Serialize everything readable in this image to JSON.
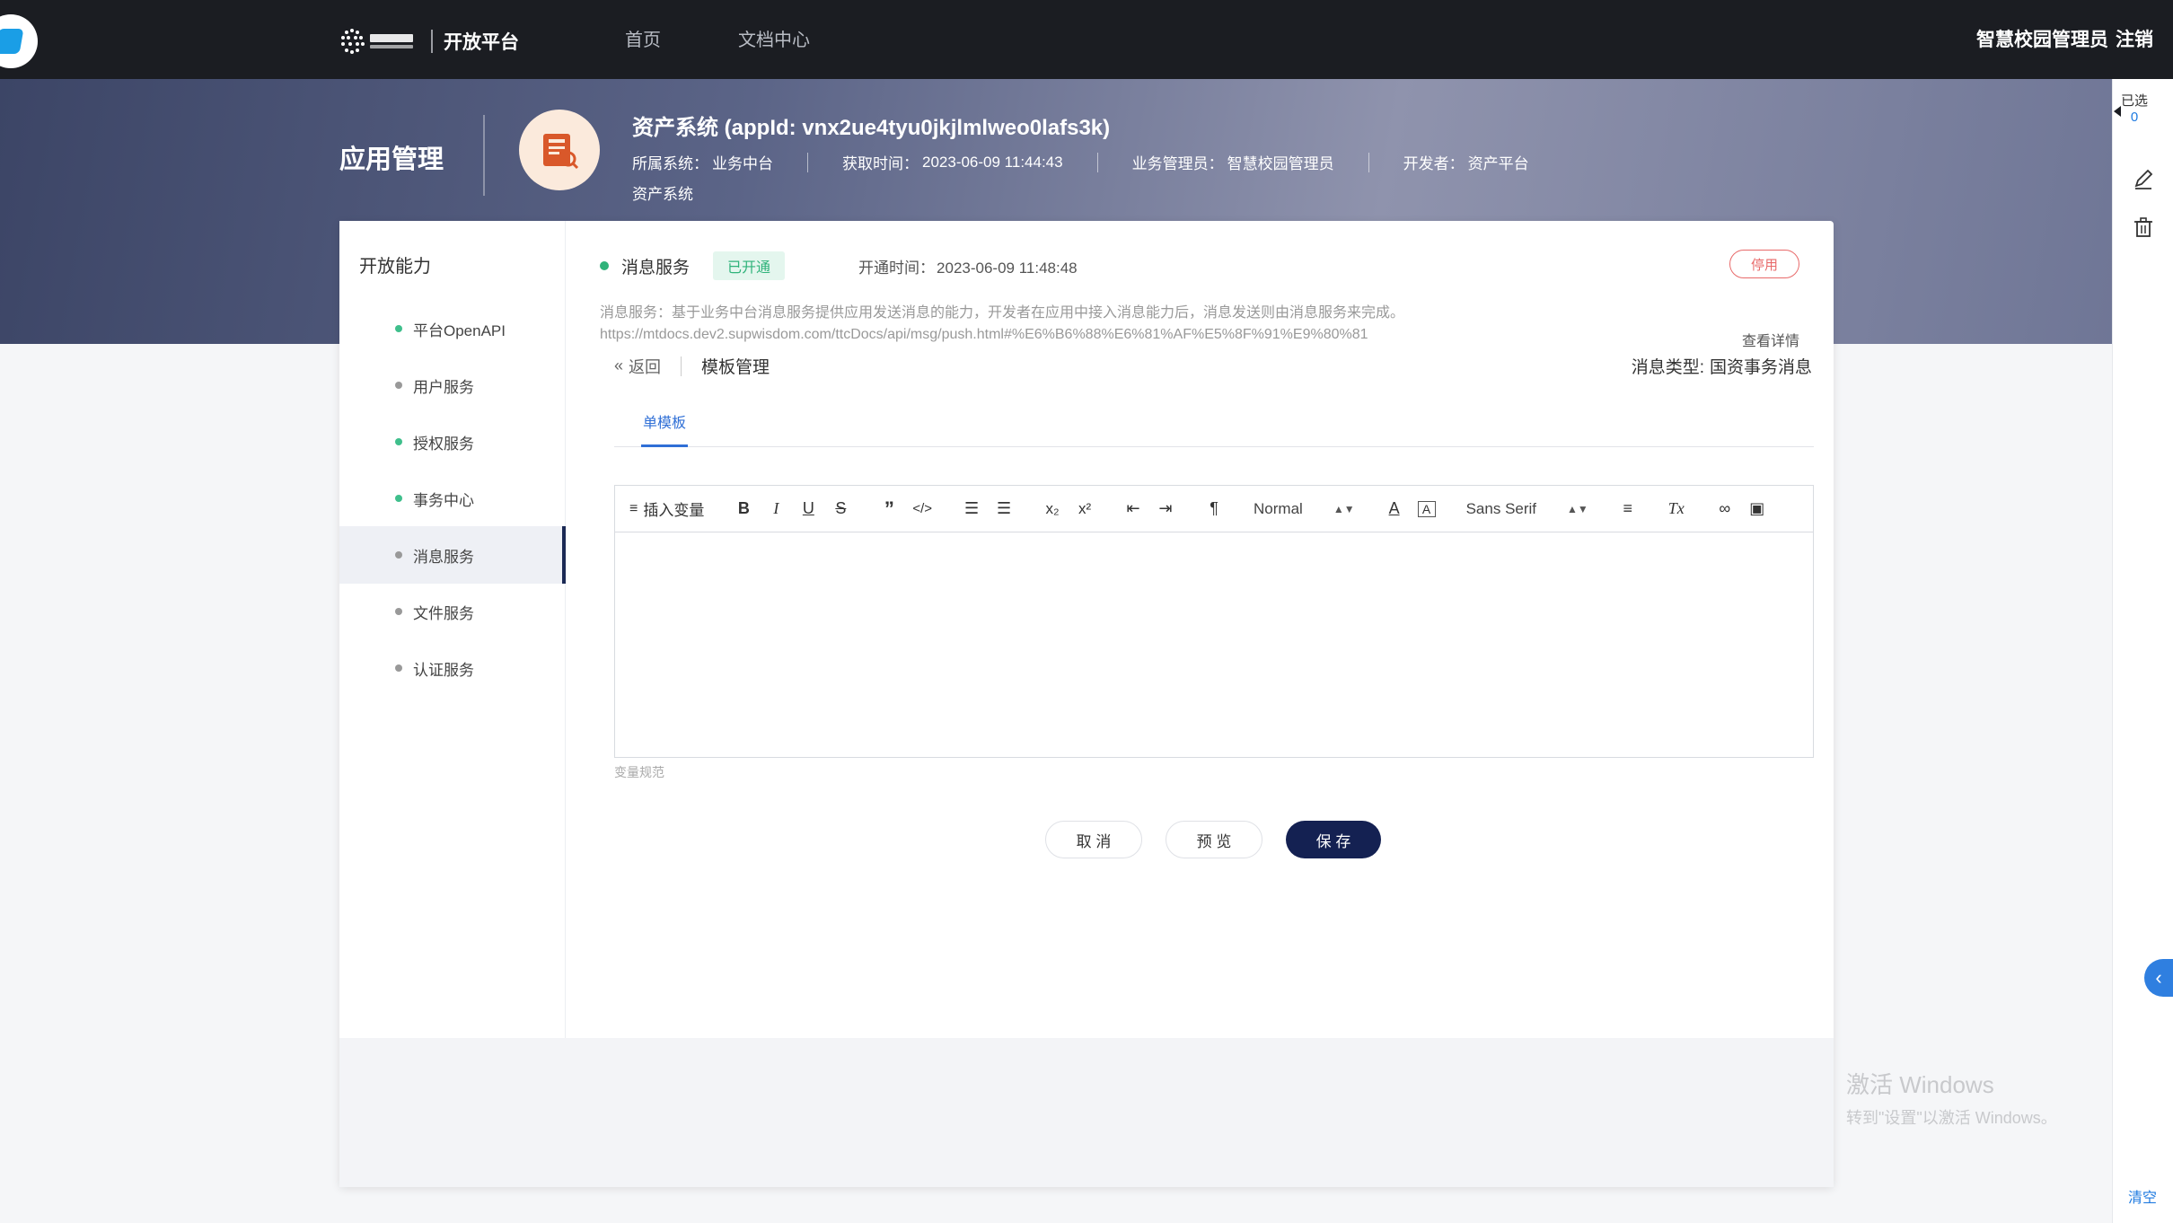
{
  "topbar": {
    "brand_title": "开放平台",
    "nav": [
      "首页",
      "文档中心"
    ],
    "user_name": "智慧校园管理员",
    "logout": "注销"
  },
  "hero": {
    "section_title": "应用管理",
    "app_name": "资产系统 (appId: vnx2ue4tyu0jkjlmlweo0lafs3k)",
    "meta": [
      {
        "label": "所属系统：",
        "value": "业务中台"
      },
      {
        "label": "获取时间：",
        "value": "2023-06-09 11:44:43"
      },
      {
        "label": "业务管理员：",
        "value": "智慧校园管理员"
      },
      {
        "label": "开发者：",
        "value": "资产平台"
      }
    ],
    "meta_second_line": "资产系统"
  },
  "side_tools": {
    "selected_label": "已选",
    "selected_count": "0",
    "clear": "清空",
    "collapse_icon": "‹"
  },
  "sidebar": {
    "title": "开放能力",
    "items": [
      {
        "label": "平台OpenAPI",
        "enabled": true
      },
      {
        "label": "用户服务",
        "enabled": false
      },
      {
        "label": "授权服务",
        "enabled": true
      },
      {
        "label": "事务中心",
        "enabled": true
      },
      {
        "label": "消息服务",
        "enabled": false,
        "active": true
      },
      {
        "label": "文件服务",
        "enabled": false
      },
      {
        "label": "认证服务",
        "enabled": false
      }
    ]
  },
  "service": {
    "name": "消息服务",
    "status": "已开通",
    "open_time_label": "开通时间：",
    "open_time": "2023-06-09 11:48:48",
    "disable_button": "停用",
    "description": "消息服务：基于业务中台消息服务提供应用发送消息的能力，开发者在应用中接入消息能力后，消息发送则由消息服务来完成。",
    "doc_url": "https://mtdocs.dev2.supwisdom.com/ttcDocs/api/msg/push.html#%E6%B6%88%E6%81%AF%E5%8F%91%E9%80%81",
    "detail_link": "查看详情"
  },
  "template": {
    "back": "返回",
    "title": "模板管理",
    "msg_type_label": "消息类型:",
    "msg_type_value": "国资事务消息",
    "tabs": [
      "单模板"
    ],
    "editor": {
      "insert_var": "插入变量",
      "heading_select": "Normal",
      "font_select": "Sans Serif",
      "content": ""
    },
    "var_rule": "变量规范"
  },
  "buttons": {
    "cancel": "取 消",
    "preview": "预 览",
    "save": "保 存"
  },
  "watermark": {
    "line1": "激活 Windows",
    "line2": "转到\"设置\"以激活 Windows。"
  },
  "colors": {
    "topbar": "#1b1d22",
    "accent": "#2f6fd6",
    "save_button": "#142152",
    "open_green": "#2fb37a",
    "disable_red": "#e86a6a"
  }
}
